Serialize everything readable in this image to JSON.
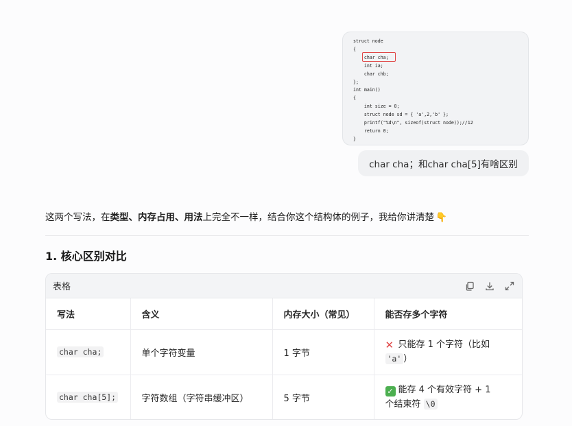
{
  "code_screenshot": {
    "lines": [
      "struct node",
      "{",
      "    char cha;",
      "    int ia;",
      "    char chb;",
      "};",
      "int main()",
      "{",
      "    int size = 0;",
      "    struct node sd = { 'a',2,'b' };",
      "    printf(\"%d\\n\", sizeof(struct node));//12",
      "    return 0;",
      "}"
    ],
    "highlight_color": "#e04848"
  },
  "user_message": "char cha；和char cha[5]有啥区别",
  "reply": {
    "intro_before": "这两个写法，在",
    "intro_bold": "类型、内存占用、用法",
    "intro_after": "上完全不一样，结合你这个结构体的例子，我给你讲清楚",
    "emoji": "👇",
    "section_heading": "1. 核心区别对比"
  },
  "table": {
    "title": "表格",
    "tools": [
      "copy-icon",
      "download-icon",
      "expand-icon"
    ],
    "headers": [
      "写法",
      "含义",
      "内存大小（常见）",
      "能否存多个字符"
    ],
    "rows": [
      {
        "code": "char cha;",
        "meaning": "单个字符变量",
        "size": "1 字节",
        "multi_icon": "cross-mark-icon",
        "multi_text": "只能存 1 个字符（比如",
        "multi_code": "'a'",
        "multi_tail": "）"
      },
      {
        "code": "char cha[5];",
        "meaning": "字符数组（字符串缓冲区）",
        "size": "5 字节",
        "multi_icon": "check-mark-icon",
        "multi_text": "能存 4 个有效字符 + 1",
        "multi_text2": "个结束符",
        "multi_code": "\\0"
      }
    ]
  }
}
